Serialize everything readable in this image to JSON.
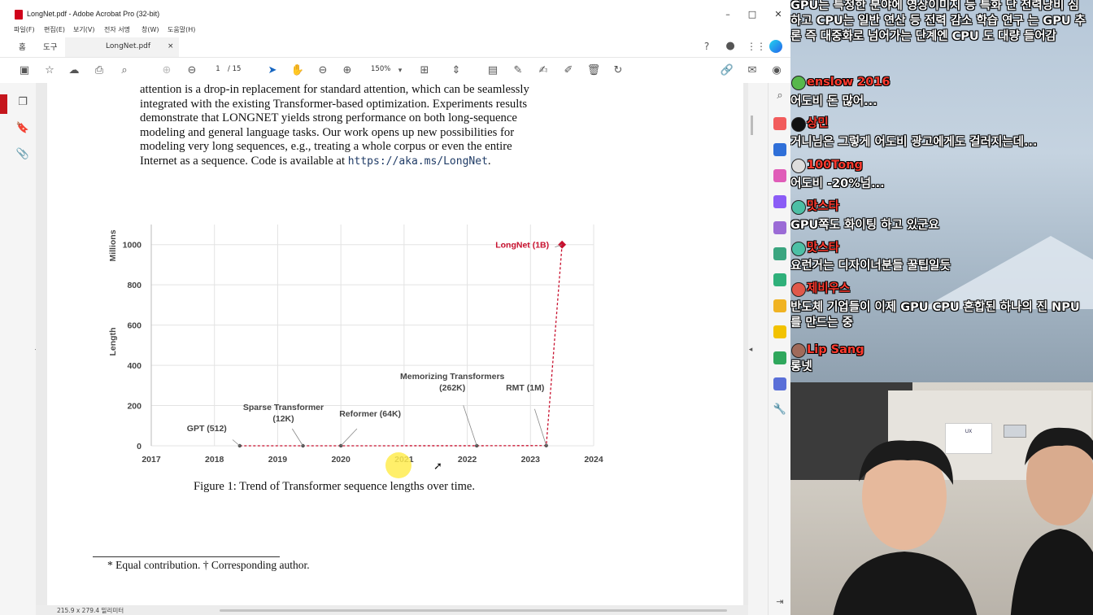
{
  "window": {
    "title": "LongNet.pdf - Adobe Acrobat Pro (32-bit)",
    "minimize": "–",
    "maximize": "□",
    "close": "✕"
  },
  "menu": [
    "파일(F)",
    "편집(E)",
    "보기(V)",
    "전자 서명",
    "창(W)",
    "도움말(H)"
  ],
  "tabs": {
    "home": "홈",
    "tools": "도구",
    "document": "LongNet.pdf",
    "close": "×"
  },
  "toolbar": {
    "current_page": "1",
    "page_count": "/ 15",
    "zoom": "150%",
    "zoom_caret": "▾",
    "icons": [
      "save-icon",
      "star-icon",
      "upload-icon",
      "print-icon",
      "zoom-search-icon",
      "page-up-icon",
      "page-down-icon",
      "select-arrow-icon",
      "hand-icon",
      "zoom-out-icon",
      "zoom-in-icon",
      "fit-page-icon",
      "scroll-mode-icon",
      "comment-icon",
      "highlight-icon",
      "sign-icon",
      "edit-icon",
      "delete-icon",
      "rotate-icon",
      "link-icon",
      "mail-icon",
      "account-icon"
    ]
  },
  "document": {
    "abstract_lines": [
      "attention is a drop-in replacement for standard attention, which can be seamlessly",
      "integrated with the existing Transformer-based optimization. Experiments results",
      "demonstrate that LONGNET yields strong performance on both long-sequence",
      "modeling and general language tasks.  Our work opens up new possibilities for",
      "modeling very long sequences, e.g., treating a whole corpus or even the entire"
    ],
    "last_line_prefix": "Internet as a sequence. Code is available at ",
    "code_url": "https://aka.ms/LongNet",
    "last_line_suffix": ".",
    "caption": "Figure 1: Trend of Transformer sequence lengths over time.",
    "footnote": "* Equal contribution. † Corresponding author."
  },
  "chart_data": {
    "type": "line",
    "ylabel": "Length",
    "yunit": "Millions",
    "xlim": [
      2017,
      2024
    ],
    "ylim": [
      0,
      1100
    ],
    "x_ticks": [
      "2017",
      "2018",
      "2019",
      "2020",
      "2021",
      "2022",
      "2023",
      "2024"
    ],
    "y_ticks": [
      "0",
      "200",
      "400",
      "600",
      "800",
      "1000"
    ],
    "grid": true,
    "series": [
      {
        "points": [
          {
            "x": 2018.4,
            "y": 0.000512,
            "label": "GPT (512)"
          },
          {
            "x": 2019.4,
            "y": 0.012,
            "label": "Sparse Transformer (12K)"
          },
          {
            "x": 2020.0,
            "y": 0.064,
            "label": "Reformer (64K)"
          },
          {
            "x": 2022.15,
            "y": 0.262,
            "label": "Memorizing Transformers (262K)"
          },
          {
            "x": 2023.25,
            "y": 1,
            "label": "RMT (1M)"
          },
          {
            "x": 2023.5,
            "y": 1000,
            "label": "LongNet (1B)"
          }
        ]
      }
    ],
    "colors": {
      "highlight": "#c8102e",
      "points": "#555555"
    }
  },
  "status": {
    "page_size": "215.9 x 279.4 밀리미터"
  },
  "chat": [
    {
      "type": "text",
      "text": "GPU는 특정한 분야에 영상이미지 등 특화 단 전력낭비 심하고 CPU는 일반 연산 등 전력 감소 학습 연구 는 GPU 추론 즉 대중화로 넘어가는 단계엔 CPU 도 대량 들어감"
    },
    {
      "type": "user",
      "name": "enslow 2016",
      "color": "#57b84c"
    },
    {
      "type": "text",
      "text": "어도비 돈 많어..."
    },
    {
      "type": "user",
      "name": "상민",
      "color": "#111111"
    },
    {
      "type": "text",
      "text": "거니님은 그렇게 어도비 광고에게도 걸러지는데..."
    },
    {
      "type": "user",
      "name": "100Tong",
      "color": "#dddddd"
    },
    {
      "type": "text",
      "text": "어도비 -20%넘..."
    },
    {
      "type": "user",
      "name": "맛스타",
      "color": "#4cbfa5"
    },
    {
      "type": "text",
      "text": "GPU쪽도 화이팅 하고 있군요"
    },
    {
      "type": "user",
      "name": "맛스타",
      "color": "#4cbfa5"
    },
    {
      "type": "text",
      "text": "요런거는 디자이너분들 꿀팁일듯"
    },
    {
      "type": "user",
      "name": "제비우스",
      "color": "#e0584a"
    },
    {
      "type": "text",
      "text": "반도체 기업들이 이제 GPU CPU 혼합된 하나의 진 NPU 를 만드는 중"
    },
    {
      "type": "user",
      "name": "Lip Sang",
      "color": "#a06a5a"
    },
    {
      "type": "text",
      "text": "롱넷"
    }
  ]
}
